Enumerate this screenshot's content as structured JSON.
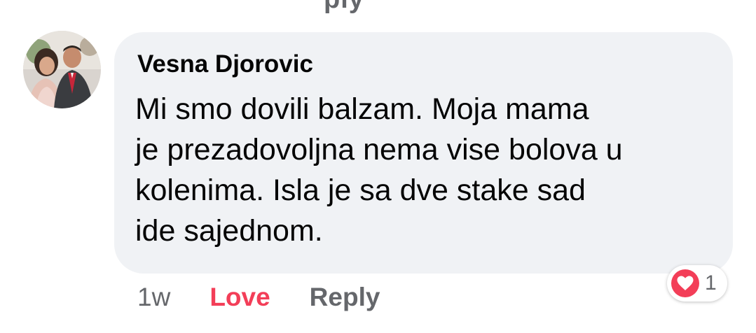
{
  "top_fragment": "ply",
  "comment": {
    "author": "Vesna Djorovic",
    "text_lines": [
      "Mi smo dovili balzam. Moja mama",
      "je prezadovoljna nema vise bolova u",
      "kolenima. Isla je sa dve stake sad",
      "ide sajednom."
    ],
    "timestamp": "1w",
    "love_label": "Love",
    "reply_label": "Reply",
    "reaction": {
      "icon": "heart-icon",
      "count": "1"
    }
  },
  "colors": {
    "bubble": "#f0f2f5",
    "love": "#f33e58",
    "secondary_text": "#65676b",
    "primary_text": "#050505"
  }
}
